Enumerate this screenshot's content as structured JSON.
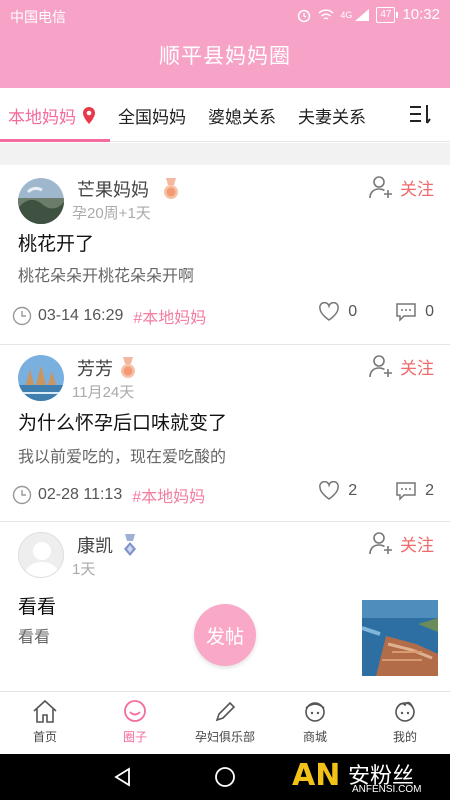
{
  "status_bar": {
    "carrier": "中国电信",
    "network": "4G",
    "battery": "47",
    "time": "10:32"
  },
  "header": {
    "title": "顺平县妈妈圈"
  },
  "tabs": [
    {
      "label": "本地妈妈",
      "active": true
    },
    {
      "label": "全国妈妈",
      "active": false
    },
    {
      "label": "婆媳关系",
      "active": false
    },
    {
      "label": "夫妻关系",
      "active": false
    }
  ],
  "posts": [
    {
      "username": "芒果妈妈",
      "subinfo": "孕20周+1天",
      "follow_label": "关注",
      "title": "桃花开了",
      "body": "桃花朵朵开桃花朵朵开啊",
      "datetime": "03-14 16:29",
      "tag": "#本地妈妈",
      "likes": "0",
      "comments": "0"
    },
    {
      "username": "芳芳",
      "subinfo": "11月24天",
      "follow_label": "关注",
      "title": "为什么怀孕后口味就变了",
      "body": "我以前爱吃的，现在爱吃酸的",
      "datetime": "02-28 11:13",
      "tag": "#本地妈妈",
      "likes": "2",
      "comments": "2"
    },
    {
      "username": "康凯",
      "subinfo": "1天",
      "follow_label": "关注",
      "title": "看看",
      "body": "看看"
    }
  ],
  "fab": {
    "label": "发帖"
  },
  "bottom_nav": [
    {
      "label": "首页",
      "icon": "home-icon",
      "active": false
    },
    {
      "label": "圈子",
      "icon": "circle-icon",
      "active": true
    },
    {
      "label": "孕妇俱乐部",
      "icon": "pencil-icon",
      "active": false
    },
    {
      "label": "商城",
      "icon": "mall-icon",
      "active": false
    },
    {
      "label": "我的",
      "icon": "profile-icon",
      "active": false
    }
  ],
  "watermark": {
    "logo": "AN",
    "name": "安粉丝",
    "url": "ANFENSI.COM"
  },
  "colors": {
    "brand_pink": "#f7a3c8",
    "accent_pink": "#f46b9e",
    "follow_red": "#ef6b6b"
  }
}
